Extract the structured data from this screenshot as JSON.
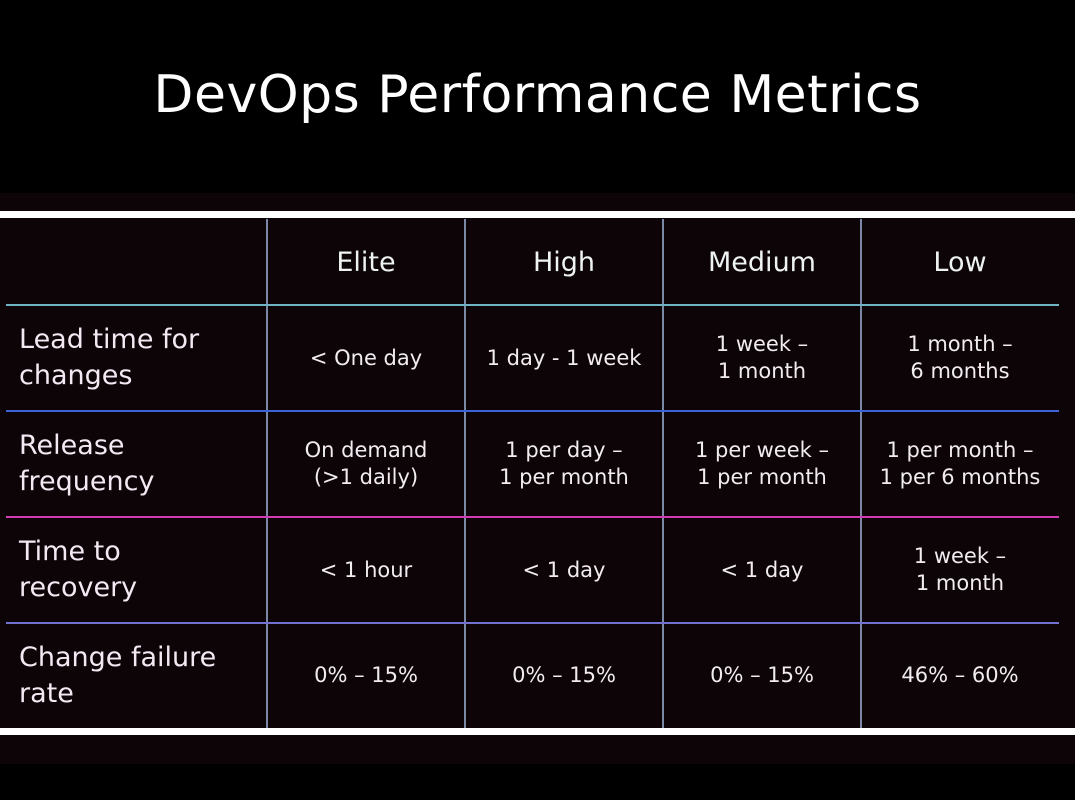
{
  "title": "DevOps Performance Metrics",
  "table": {
    "columns": [
      "",
      "Elite",
      "High",
      "Medium",
      "Low"
    ],
    "rows": [
      {
        "label": "Lead time for\nchanges",
        "cells": [
          "< One day",
          "1 day - 1 week",
          "1 week –\n1 month",
          "1 month –\n6 months"
        ]
      },
      {
        "label": "Release\nfrequency",
        "cells": [
          "On demand\n(>1 daily)",
          "1 per day –\n1 per month",
          "1 per week –\n1 per month",
          "1 per month –\n1 per 6 months"
        ]
      },
      {
        "label": "Time to\nrecovery",
        "cells": [
          "< 1 hour",
          "< 1 day",
          "< 1 day",
          "1 week –\n1 month"
        ]
      },
      {
        "label": "Change failure\nrate",
        "cells": [
          "0% – 15%",
          "0% – 15%",
          "0% – 15%",
          "46% – 60%"
        ]
      }
    ]
  },
  "colors": {
    "row_dividers": [
      "#6fb3c4",
      "#3b63d6",
      "#d23bb4",
      "#7371d2"
    ],
    "column_dividers": "#7a8aa6"
  }
}
